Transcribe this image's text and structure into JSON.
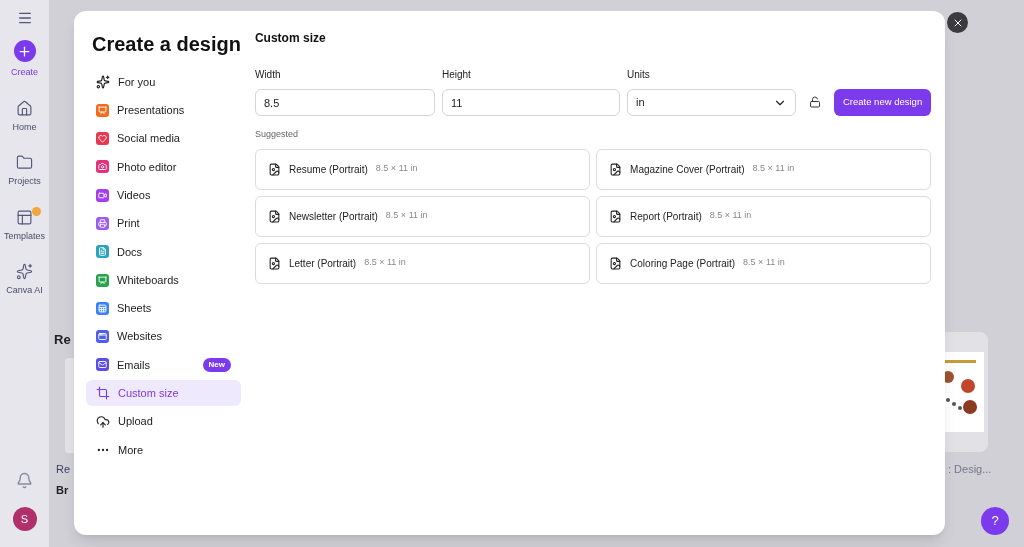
{
  "rail": {
    "items": [
      {
        "kind": "create",
        "label": "Create",
        "selected": true
      },
      {
        "kind": "home",
        "label": "Home",
        "selected": false
      },
      {
        "kind": "projects",
        "label": "Projects",
        "selected": false
      },
      {
        "kind": "templates",
        "label": "Templates",
        "selected": false
      },
      {
        "kind": "ai",
        "label": "Canva AI",
        "selected": false
      }
    ],
    "avatar": "S"
  },
  "background": {
    "fragments": [
      "Re",
      "Re",
      "Br",
      ": Desig..."
    ]
  },
  "dialog": {
    "title": "Create a design",
    "categories": [
      {
        "kind": "foryou",
        "label": "For you",
        "selected": false
      },
      {
        "kind": "presentations",
        "label": "Presentations",
        "selected": false
      },
      {
        "kind": "social",
        "label": "Social media",
        "selected": false
      },
      {
        "label": "Photo editor",
        "selected": false
      },
      {
        "kind": "videos",
        "label": "Videos",
        "selected": false
      },
      {
        "kind": "print",
        "label": "Print",
        "selected": false
      },
      {
        "kind": "docs",
        "label": "Docs",
        "selected": false
      },
      {
        "kind": "whiteboards",
        "label": "Whiteboards",
        "selected": false
      },
      {
        "kind": "sheets",
        "label": "Sheets",
        "selected": false
      },
      {
        "kind": "websites",
        "label": "Websites",
        "selected": false
      },
      {
        "kind": "emails",
        "label": "Emails",
        "selected": false,
        "badge": "New"
      },
      {
        "kind": "custom",
        "label": "Custom size",
        "selected": true
      },
      {
        "kind": "upload",
        "label": "Upload",
        "selected": false
      },
      {
        "kind": "more",
        "label": "More",
        "selected": false
      }
    ],
    "section_title": "Custom size",
    "width": {
      "label": "Width",
      "value": "8.5"
    },
    "height": {
      "label": "Height",
      "value": "11"
    },
    "units": {
      "label": "Units",
      "value": "in"
    },
    "create_button": "Create new design",
    "suggested_label": "Suggested",
    "suggestions": [
      {
        "name": "Resume (Portrait)",
        "size": "8.5 × 11 in"
      },
      {
        "name": "Magazine Cover (Portrait)",
        "size": "8.5 × 11 in"
      },
      {
        "name": "Newsletter (Portrait)",
        "size": "8.5 × 11 in"
      },
      {
        "name": "Report (Portrait)",
        "size": "8.5 × 11 in"
      },
      {
        "name": "Letter (Portrait)",
        "size": "8.5 × 11 in"
      },
      {
        "name": "Coloring Page (Portrait)",
        "size": "8.5 × 11 in"
      }
    ]
  },
  "help_button": "?"
}
